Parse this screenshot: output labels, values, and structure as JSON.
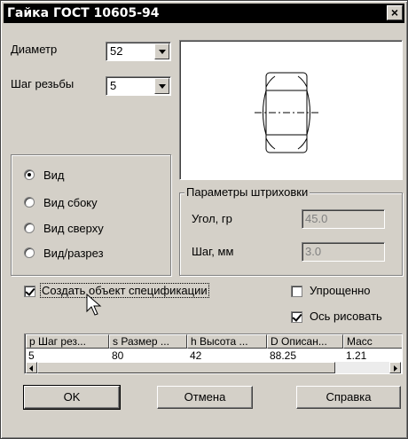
{
  "window": {
    "title": "Гайка ГОСТ 10605-94",
    "close_icon": "close-icon"
  },
  "diameter": {
    "label": "Диаметр",
    "value": "52"
  },
  "thread_step": {
    "label": "Шаг резьбы",
    "value": "5"
  },
  "view_options": {
    "items": [
      {
        "label": "Вид",
        "selected": true
      },
      {
        "label": "Вид сбоку",
        "selected": false
      },
      {
        "label": "Вид сверху",
        "selected": false
      },
      {
        "label": "Вид/разрез",
        "selected": false
      }
    ]
  },
  "hatch": {
    "title": "Параметры штриховки",
    "angle_label": "Угол, гр",
    "angle_value": "45.0",
    "step_label": "Шаг, мм",
    "step_value": "3.0"
  },
  "checkboxes": {
    "create_spec": {
      "label": "Создать объект спецификации",
      "checked": true
    },
    "simplified": {
      "label": "Упрощенно",
      "checked": false
    },
    "draw_axis": {
      "label": "Ось рисовать",
      "checked": true
    }
  },
  "table": {
    "columns": [
      "p Шаг рез...",
      "s Размер ...",
      "h Высота ...",
      "D Описан...",
      "Масс"
    ],
    "rows": [
      [
        "5",
        "80",
        "42",
        "88.25",
        "1.21"
      ]
    ]
  },
  "buttons": {
    "ok": "OK",
    "cancel": "Отмена",
    "help": "Справка"
  }
}
